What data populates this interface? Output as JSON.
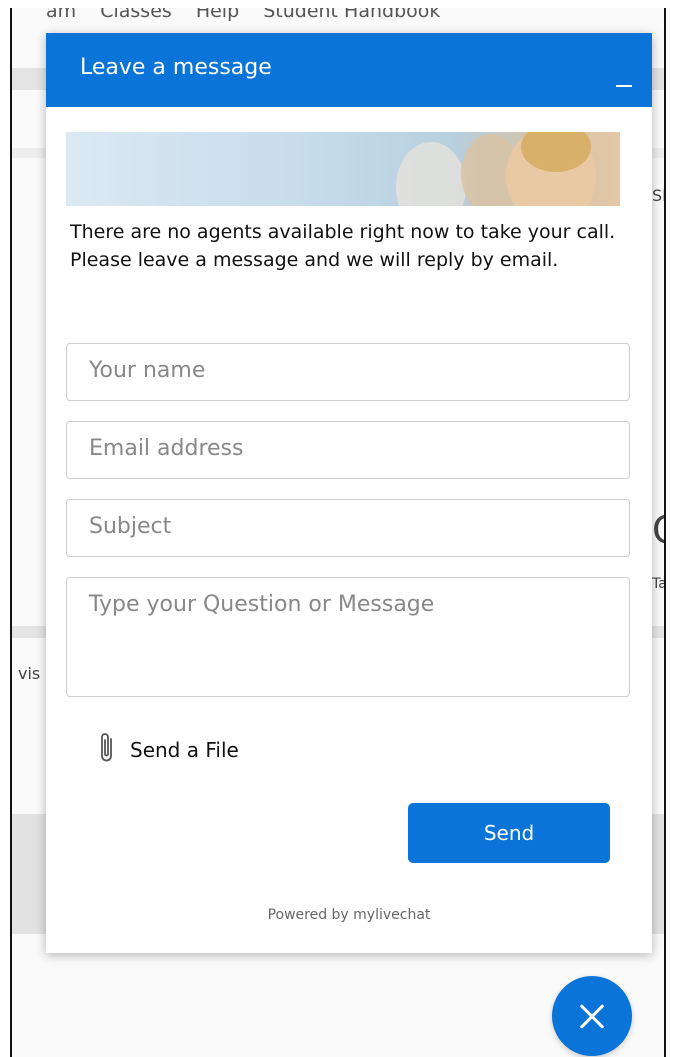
{
  "background_page": {
    "nav_items": [
      "am",
      "Classes",
      "Help",
      "Student Handbook"
    ],
    "edge_text": [
      "SE",
      "C",
      "Ta",
      "vis"
    ]
  },
  "widget": {
    "title": "Leave a message",
    "intro": "There are no agents available right now to take your call. Please leave a message and we will reply by email.",
    "fields": {
      "name_placeholder": "Your name",
      "email_placeholder": "Email address",
      "subject_placeholder": "Subject",
      "message_placeholder": "Type your Question or Message"
    },
    "attach_label": "Send a File",
    "send_label": "Send",
    "powered_by": "Powered by mylivechat"
  },
  "colors": {
    "accent": "#0a74d8",
    "text": "#111111",
    "placeholder": "#888888"
  },
  "icons": {
    "minimize": "minimize-icon",
    "attach": "paperclip-icon",
    "close": "close-icon"
  }
}
